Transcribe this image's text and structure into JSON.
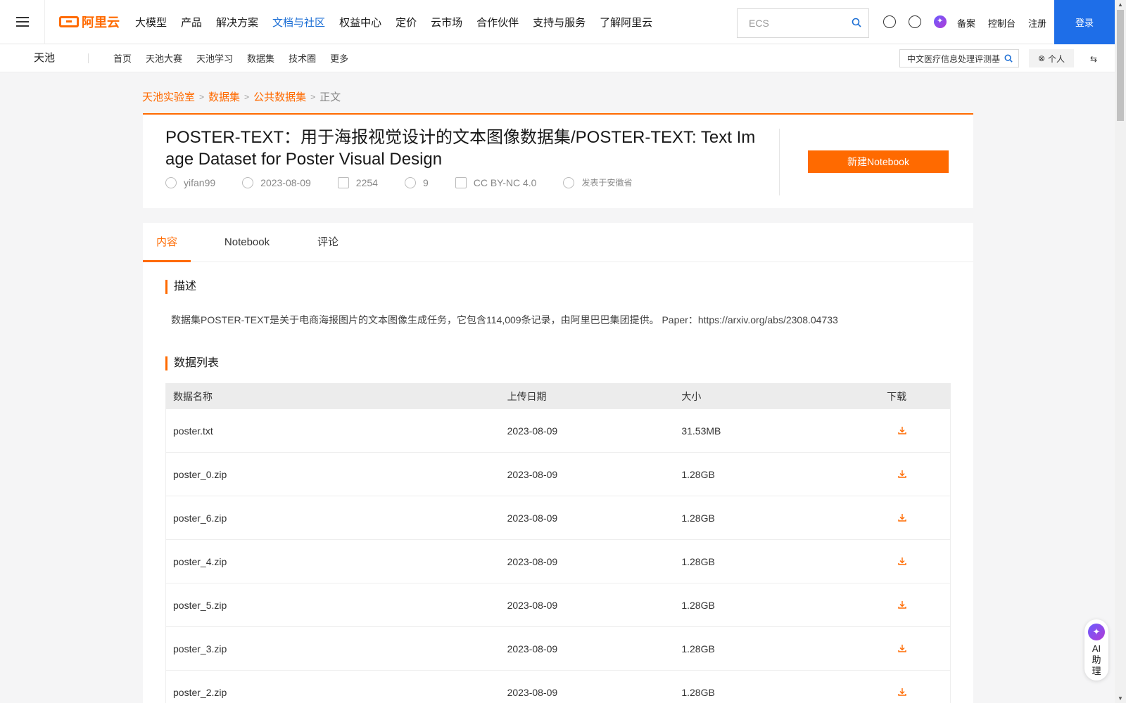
{
  "topbar": {
    "logo_text": "阿里云",
    "nav": [
      "大模型",
      "产品",
      "解决方案",
      "文档与社区",
      "权益中心",
      "定价",
      "云市场",
      "合作伙伴",
      "支持与服务",
      "了解阿里云"
    ],
    "active_nav": "文档与社区",
    "search_placeholder": "ECS",
    "links": [
      "备案",
      "控制台",
      "注册"
    ],
    "login": "登录"
  },
  "subbar": {
    "brand": "天池",
    "nav": [
      "首页",
      "天池大赛",
      "天池学习",
      "数据集",
      "技术圈",
      "更多"
    ],
    "search_value": "中文医疗信息处理评测基",
    "personal": "个人"
  },
  "breadcrumb": [
    "天池实验室",
    "数据集",
    "公共数据集",
    "正文"
  ],
  "dataset": {
    "title": "POSTER-TEXT：用于海报视觉设计的文本图像数据集/POSTER-TEXT: Text Image Dataset for Poster Visual Design",
    "author": "yifan99",
    "date": "2023-08-09",
    "downloads": "2254",
    "shares": "9",
    "license": "CC BY-NC 4.0",
    "location": "发表于安徽省",
    "new_notebook": "新建Notebook"
  },
  "tabs": [
    "内容",
    "Notebook",
    "评论"
  ],
  "description": {
    "title": "描述",
    "text": "数据集POSTER-TEXT是关于电商海报图片的文本图像生成任务，它包含114,009条记录，由阿里巴巴集团提供。 Paper：https://arxiv.org/abs/2308.04733"
  },
  "data_list": {
    "title": "数据列表",
    "headers": [
      "数据名称",
      "上传日期",
      "大小",
      "下载"
    ],
    "rows": [
      {
        "name": "poster.txt",
        "date": "2023-08-09",
        "size": "31.53MB"
      },
      {
        "name": "poster_0.zip",
        "date": "2023-08-09",
        "size": "1.28GB"
      },
      {
        "name": "poster_6.zip",
        "date": "2023-08-09",
        "size": "1.28GB"
      },
      {
        "name": "poster_4.zip",
        "date": "2023-08-09",
        "size": "1.28GB"
      },
      {
        "name": "poster_5.zip",
        "date": "2023-08-09",
        "size": "1.28GB"
      },
      {
        "name": "poster_3.zip",
        "date": "2023-08-09",
        "size": "1.28GB"
      },
      {
        "name": "poster_2.zip",
        "date": "2023-08-09",
        "size": "1.28GB"
      }
    ]
  },
  "ai_helper": {
    "label_1": "AI",
    "label_2": "助",
    "label_3": "理"
  },
  "colors": {
    "accent": "#ff6a00",
    "link_blue": "#1a6dd4",
    "login_blue": "#1e6ee8"
  }
}
